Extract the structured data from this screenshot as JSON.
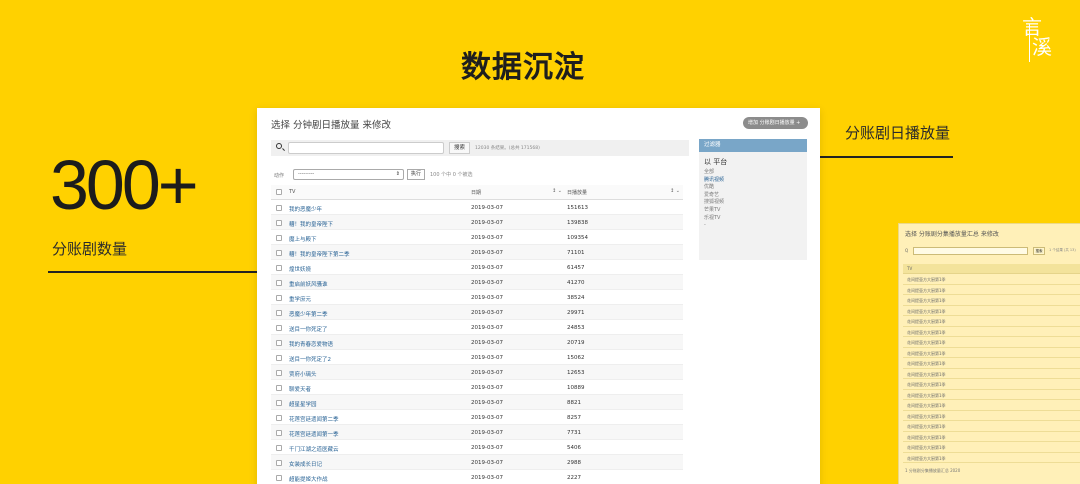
{
  "logo": {
    "char1": "言",
    "char2": "溪"
  },
  "hero": {
    "title": "数据沉淀"
  },
  "stats": {
    "big_number": "300+",
    "left_label": "分账剧数量",
    "right_label": "分账剧日播放量"
  },
  "panel": {
    "title": "选择 分钟剧日播放量 来修改",
    "add_button": "增加 分账剧日播放量 +",
    "search": {
      "button": "搜索",
      "hint": "12030 条结果。(总共 171568)"
    },
    "actions": {
      "label": "动作",
      "select_value": "---------",
      "go_button": "执行",
      "selected_count": "100 个中 0 个被选"
    },
    "columns": {
      "title": "TV",
      "date": "日期",
      "count": "日播放量",
      "sort_glyph": "↕ ⌄"
    },
    "rows": [
      {
        "title": "我的恶魔少年",
        "date": "2019-03-07",
        "count": "151613"
      },
      {
        "title": "糟！我的皇帝陛下",
        "date": "2019-03-07",
        "count": "139838"
      },
      {
        "title": "魔上与殿下",
        "date": "2019-03-07",
        "count": "109354"
      },
      {
        "title": "糟！我的皇帝陛下第二季",
        "date": "2019-03-07",
        "count": "71101"
      },
      {
        "title": "煌世妖娆",
        "date": "2019-03-07",
        "count": "61457"
      },
      {
        "title": "重启前妖风骚谁",
        "date": "2019-03-07",
        "count": "41270"
      },
      {
        "title": "重学庶元",
        "date": "2019-03-07",
        "count": "38524"
      },
      {
        "title": "恶魔少年第二季",
        "date": "2019-03-07",
        "count": "29971"
      },
      {
        "title": "送目一你死定了",
        "date": "2019-03-07",
        "count": "24853"
      },
      {
        "title": "我的青春恋爱物语",
        "date": "2019-03-07",
        "count": "20719"
      },
      {
        "title": "送目一你死定了2",
        "date": "2019-03-07",
        "count": "15062"
      },
      {
        "title": "贾府小璃头",
        "date": "2019-03-07",
        "count": "12653"
      },
      {
        "title": "聊爱天者",
        "date": "2019-03-07",
        "count": "10889"
      },
      {
        "title": "超星星学园",
        "date": "2019-03-07",
        "count": "8821"
      },
      {
        "title": "花莲宫廷遗闻第二季",
        "date": "2019-03-07",
        "count": "8257"
      },
      {
        "title": "花莲宫廷遗闻第一季",
        "date": "2019-03-07",
        "count": "7731"
      },
      {
        "title": "千门江湖之道医藏云",
        "date": "2019-03-07",
        "count": "5406"
      },
      {
        "title": "女装成长日记",
        "date": "2019-03-07",
        "count": "2988"
      },
      {
        "title": "超能提姬大作战",
        "date": "2019-03-07",
        "count": "2227"
      }
    ],
    "filter": {
      "header": "过滤器",
      "subtitle": "以 平台",
      "items": [
        "全部",
        "腾讯视频",
        "优酷",
        "爱奇艺",
        "搜狐视频",
        "芒果TV",
        "乐视TV",
        "-"
      ],
      "active_index": 1
    }
  },
  "peek": {
    "title": "选择 分账剧分集播放量汇总 来修改",
    "search_label": "Q",
    "button": "搜索",
    "hint": "1 个结果   (共 13)",
    "column": "TV",
    "rows": [
      "花间提壶方大厨第1季",
      "花间提壶方大厨第1季",
      "花间提壶方大厨第1季",
      "花间提壶方大厨第1季",
      "花间提壶方大厨第1季",
      "花间提壶方大厨第1季",
      "花间提壶方大厨第1季",
      "花间提壶方大厨第1季",
      "花间提壶方大厨第1季",
      "花间提壶方大厨第1季",
      "花间提壶方大厨第1季",
      "花间提壶方大厨第1季",
      "花间提壶方大厨第1季",
      "花间提壶方大厨第1季",
      "花间提壶方大厨第1季",
      "花间提壶方大厨第1季",
      "花间提壶方大厨第1季",
      "花间提壶方大厨第1季"
    ],
    "footer": "1 分账剧分集播放量汇总 2020"
  }
}
